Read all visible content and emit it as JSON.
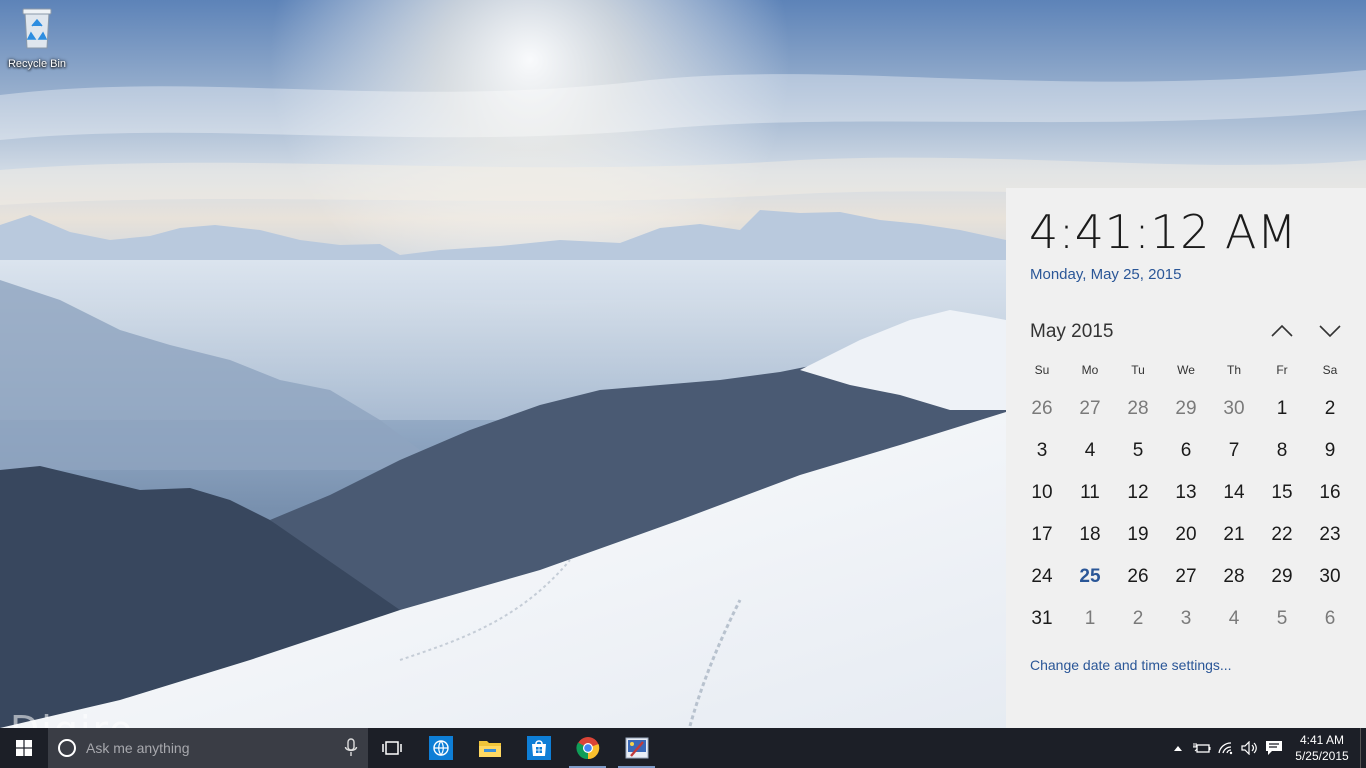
{
  "desktop": {
    "icons": [
      {
        "label": "Recycle Bin",
        "icon": "recycle-bin-icon"
      }
    ],
    "watermark": "Digiro"
  },
  "flyout": {
    "time": "4:41:12 AM",
    "date": "Monday, May 25, 2015",
    "month_title": "May 2015",
    "weekdays": [
      "Su",
      "Mo",
      "Tu",
      "We",
      "Th",
      "Fr",
      "Sa"
    ],
    "days": [
      {
        "d": "26",
        "other": true
      },
      {
        "d": "27",
        "other": true
      },
      {
        "d": "28",
        "other": true
      },
      {
        "d": "29",
        "other": true
      },
      {
        "d": "30",
        "other": true
      },
      {
        "d": "1"
      },
      {
        "d": "2"
      },
      {
        "d": "3"
      },
      {
        "d": "4"
      },
      {
        "d": "5"
      },
      {
        "d": "6"
      },
      {
        "d": "7"
      },
      {
        "d": "8"
      },
      {
        "d": "9"
      },
      {
        "d": "10"
      },
      {
        "d": "11"
      },
      {
        "d": "12"
      },
      {
        "d": "13"
      },
      {
        "d": "14"
      },
      {
        "d": "15"
      },
      {
        "d": "16"
      },
      {
        "d": "17"
      },
      {
        "d": "18"
      },
      {
        "d": "19"
      },
      {
        "d": "20"
      },
      {
        "d": "21"
      },
      {
        "d": "22"
      },
      {
        "d": "23"
      },
      {
        "d": "24"
      },
      {
        "d": "25",
        "today": true
      },
      {
        "d": "26"
      },
      {
        "d": "27"
      },
      {
        "d": "28"
      },
      {
        "d": "29"
      },
      {
        "d": "30"
      },
      {
        "d": "31"
      },
      {
        "d": "1",
        "other": true
      },
      {
        "d": "2",
        "other": true
      },
      {
        "d": "3",
        "other": true
      },
      {
        "d": "4",
        "other": true
      },
      {
        "d": "5",
        "other": true
      },
      {
        "d": "6",
        "other": true
      }
    ],
    "settings_link": "Change date and time settings..."
  },
  "taskbar": {
    "search_placeholder": "Ask me anything",
    "apps": [
      {
        "name": "internet-explorer-icon",
        "running": false
      },
      {
        "name": "file-explorer-icon",
        "running": false
      },
      {
        "name": "store-icon",
        "running": false
      },
      {
        "name": "chrome-icon",
        "running": true
      },
      {
        "name": "paint-app-icon",
        "running": true
      }
    ],
    "clock": {
      "time": "4:41 AM",
      "date": "5/25/2015"
    }
  },
  "colors": {
    "accent": "#2a5697",
    "taskbar": "#1c1f27",
    "flyout_bg": "#f0f0f0",
    "search_bg": "#3a3d45"
  }
}
